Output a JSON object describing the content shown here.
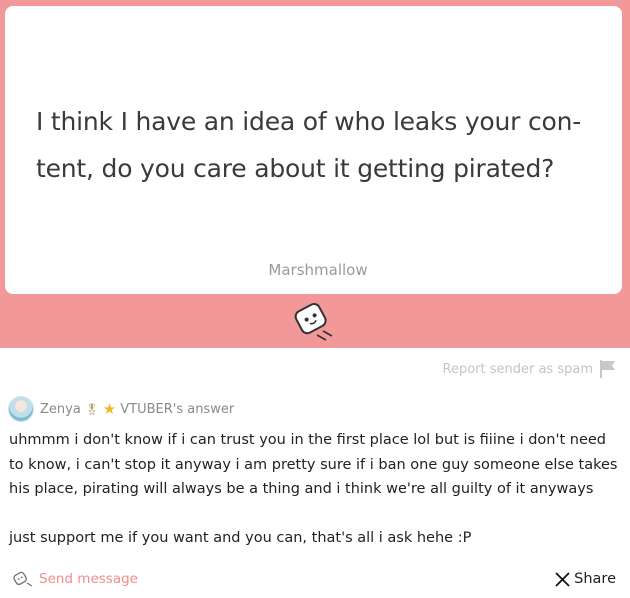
{
  "question": {
    "text": "I think I have an idea of who leaks your con- tent, do you care about it getting pirated?",
    "brand": "Marshmallow"
  },
  "report_label": "Report sender as spam",
  "answerer": {
    "name": "Zenya",
    "badge_text": "VTUBER's answer"
  },
  "answer": {
    "paragraphs": [
      "uhmmm i don't know if i can trust you in the first place lol but is fiiine i don't need to know, i can't stop it anyway i am pretty sure if i ban one guy someone else takes his place, pirating will always be a thing and i think we're all guilty of it anyways",
      "just support me if you want and you can, that's all i ask hehe :P"
    ]
  },
  "footer": {
    "send_label": "Send message",
    "share_label": "Share"
  },
  "icons": {
    "mascot": "marshmallow-mascot-icon",
    "report": "flag-icon",
    "send": "marshmallow-send-icon",
    "share": "x-logo-icon"
  },
  "colors": {
    "band": "#f29898",
    "accent_link": "#f08c8c"
  }
}
